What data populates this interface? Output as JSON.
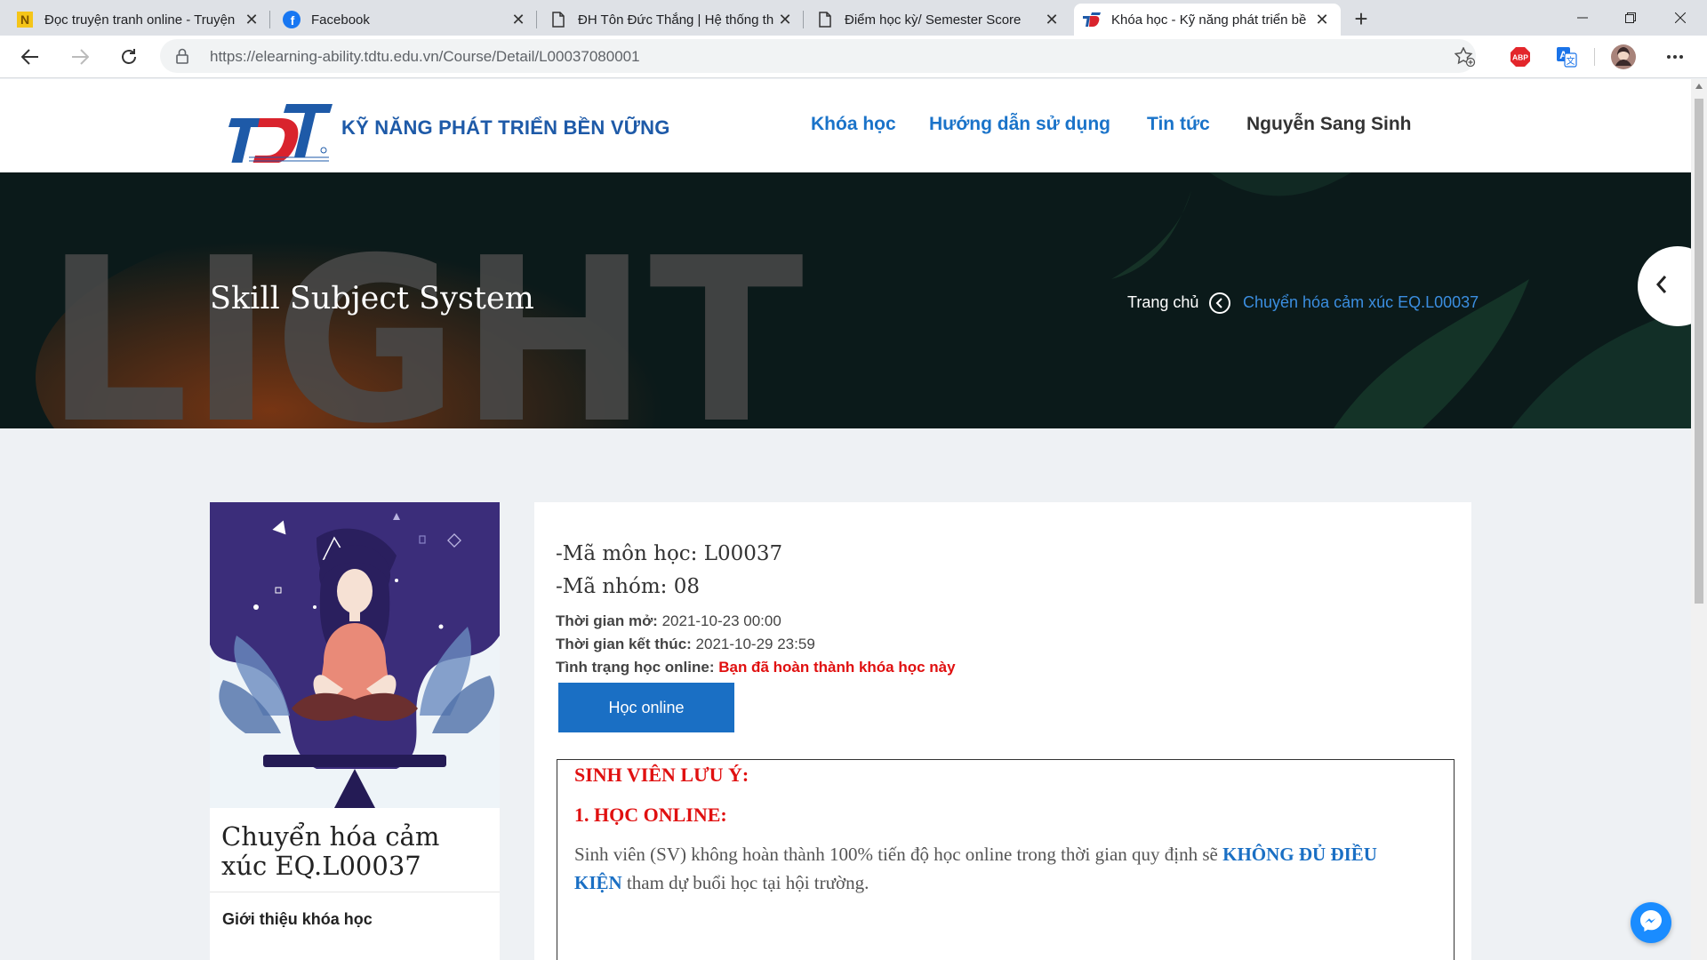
{
  "browser": {
    "tabs": [
      {
        "title": "Đọc truyện tranh online - Truyện",
        "icon": "nettruyen-favicon"
      },
      {
        "title": "Facebook",
        "icon": "facebook-favicon"
      },
      {
        "title": "ĐH Tôn Đức Thắng | Hệ thống th",
        "icon": "page-favicon"
      },
      {
        "title": "Điểm học kỳ/ Semester Score",
        "icon": "page-favicon"
      },
      {
        "title": "Khóa học - Kỹ năng phát triển bề",
        "icon": "tdtu-favicon",
        "active": true
      }
    ],
    "url": "https://elearning-ability.tdtu.edu.vn/Course/Detail/L00037080001",
    "extensions": [
      "adblock-icon",
      "translate-icon",
      "profile-avatar",
      "more-icon"
    ]
  },
  "site": {
    "name": "KỸ NĂNG PHÁT TRIỂN BỀN VỮNG",
    "nav": {
      "courses": "Khóa học",
      "guide": "Hướng dẫn sử dụng",
      "news": "Tin tức",
      "user": "Nguyễn Sang Sinh"
    }
  },
  "hero": {
    "title": "Skill Subject System",
    "breadcrumb_home": "Trang chủ",
    "breadcrumb_current": "Chuyển hóa cảm xúc EQ.L00037",
    "background_word": "LIGHT"
  },
  "course": {
    "title": "Chuyển hóa cảm xúc EQ.L00037",
    "intro_link": "Giới thiệu khóa học",
    "code_line": "-Mã môn học: L00037",
    "group_line": "-Mã nhóm: 08",
    "open_label": "Thời gian mở:",
    "open_value": "2021-10-23 00:00",
    "end_label": "Thời gian kết thúc:",
    "end_value": "2021-10-29 23:59",
    "status_label": "Tình trạng học online:",
    "status_value": "Bạn đã hoàn thành khóa học này",
    "button": "Học online"
  },
  "notice": {
    "heading": "SINH VIÊN LƯU Ý:",
    "section": "1. HỌC ONLINE:",
    "text_before": "Sinh viên (SV) không hoàn thành 100% tiến độ học online trong thời gian quy định sẽ",
    "text_emphasis": "KHÔNG ĐỦ ĐIỀU KIỆN",
    "text_after": "tham dự buổi học tại hội trường."
  },
  "colors": {
    "brand_blue": "#1a73c9",
    "button_blue": "#1a6fc4",
    "alert_red": "#e01010",
    "hero_bg": "#0b1a1a"
  }
}
